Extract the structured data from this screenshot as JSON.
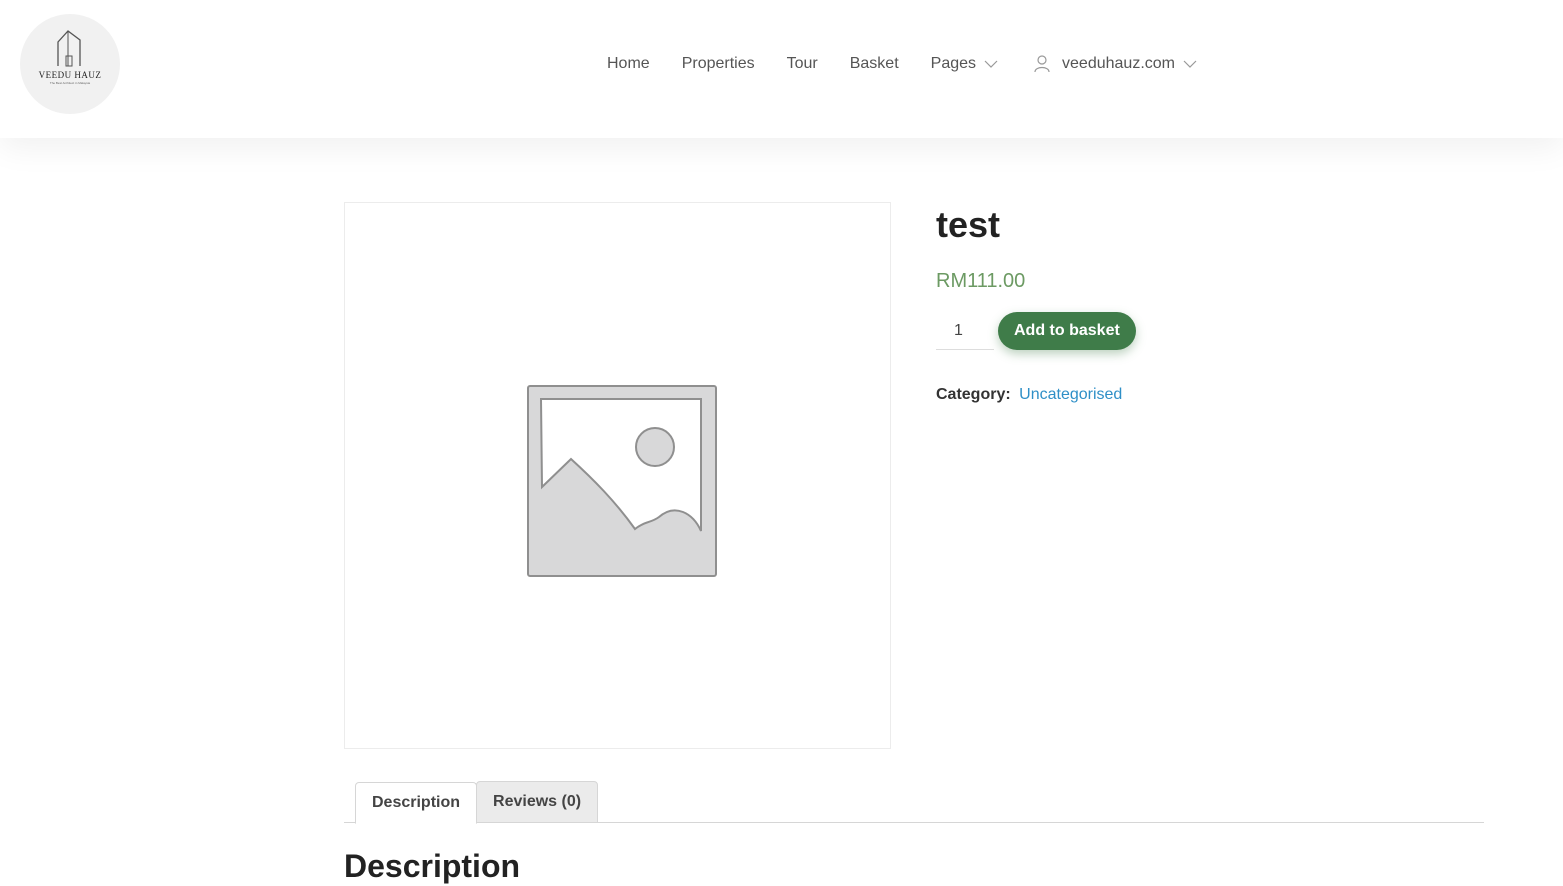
{
  "header": {
    "logo": {
      "name": "VEEDU HAUZ",
      "tagline": "The Best Architect in Malaysia"
    },
    "nav": [
      {
        "label": "Home"
      },
      {
        "label": "Properties"
      },
      {
        "label": "Tour"
      },
      {
        "label": "Basket"
      },
      {
        "label": "Pages",
        "has_dropdown": true
      }
    ],
    "account": {
      "label": "veeduhauz.com",
      "icon": "user-icon",
      "has_dropdown": true
    }
  },
  "product": {
    "title": "test",
    "price": "RM111.00",
    "quantity": "1",
    "add_to_cart_label": "Add to basket",
    "category_label": "Category:",
    "category_value": "Uncategorised",
    "image": "image-placeholder-icon"
  },
  "tabs": [
    {
      "label": "Description",
      "active": true
    },
    {
      "label": "Reviews (0)",
      "active": false
    }
  ],
  "section_title": "Description",
  "colors": {
    "price": "#6c9a63",
    "button": "#3f7c49",
    "link": "#2e8fc7"
  }
}
